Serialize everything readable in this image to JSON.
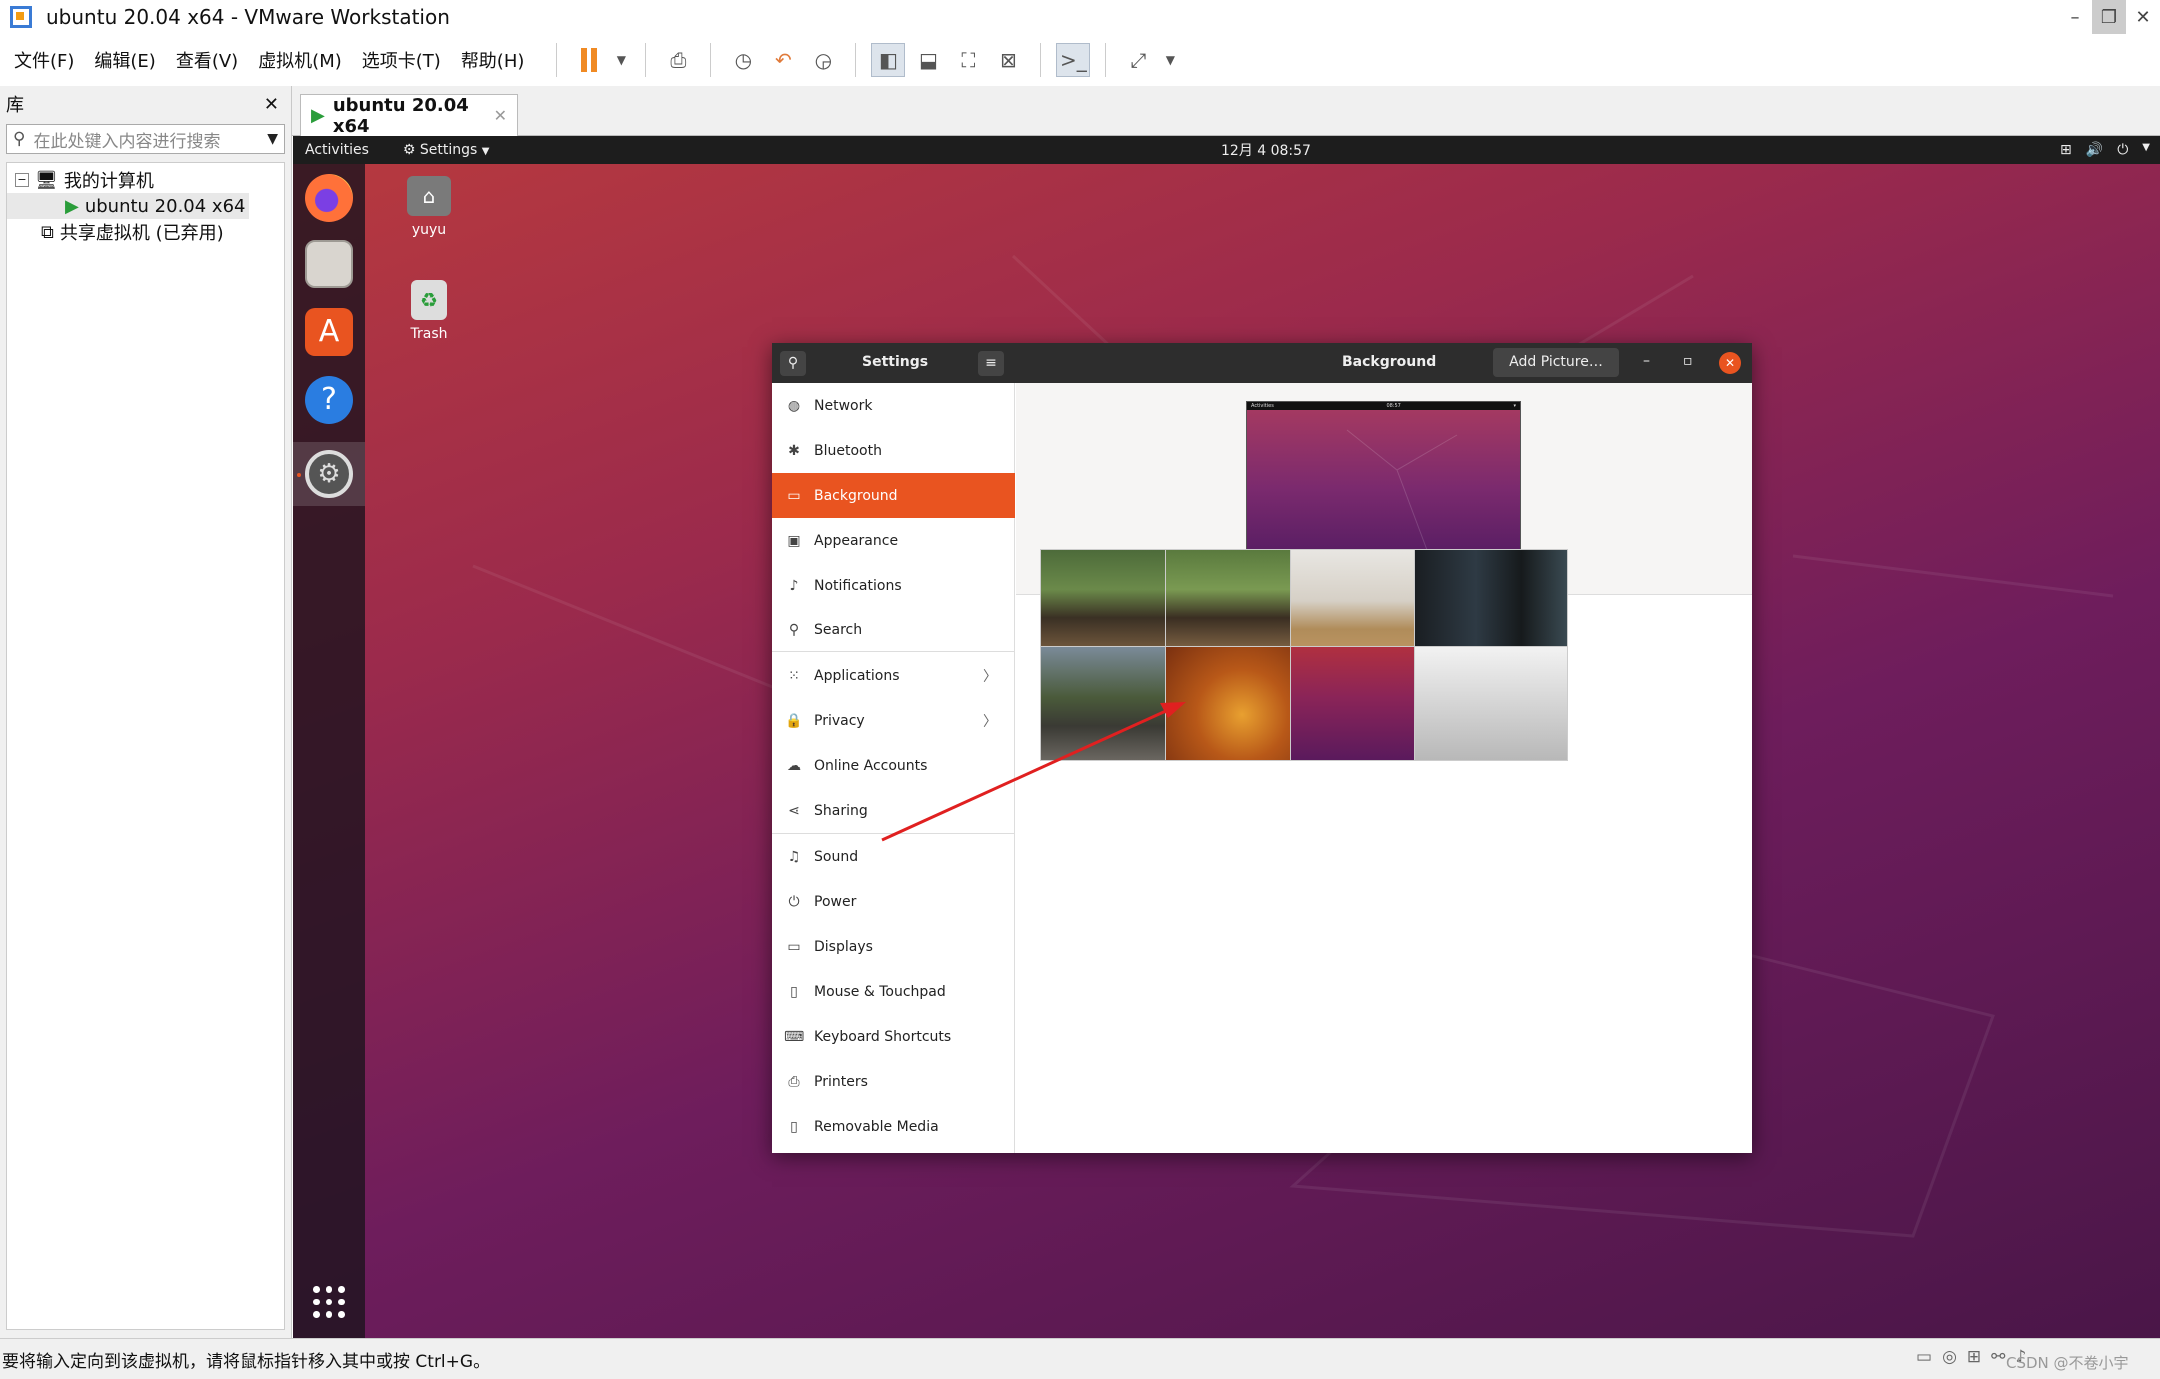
{
  "window": {
    "title": "ubuntu 20.04 x64 - VMware Workstation",
    "minimize": "–",
    "restore": "❐",
    "close": "✕"
  },
  "menu": [
    "文件(F)",
    "编辑(E)",
    "查看(V)",
    "虚拟机(M)",
    "选项卡(T)",
    "帮助(H)"
  ],
  "library": {
    "title": "库",
    "close": "✕",
    "search_placeholder": "在此处键入内容进行搜索",
    "tree": [
      {
        "label": "我的计算机"
      },
      {
        "label": "ubuntu 20.04 x64"
      },
      {
        "label": "共享虚拟机 (已弃用)"
      }
    ]
  },
  "tab": {
    "label": "ubuntu 20.04 x64",
    "close": "✕"
  },
  "ubuntu": {
    "activities": "Activities",
    "app_menu": "Settings",
    "clock": "12月 4  08:57",
    "desktop": [
      {
        "label": "yuyu"
      },
      {
        "label": "Trash"
      }
    ]
  },
  "settings": {
    "sidebar_title": "Settings",
    "page_title": "Background",
    "add_picture": "Add Picture…",
    "items": [
      {
        "label": "Network",
        "icon": "globe-icon",
        "glyph": "◍"
      },
      {
        "label": "Bluetooth",
        "icon": "bluetooth-icon",
        "glyph": "✱"
      },
      {
        "label": "Background",
        "icon": "background-icon",
        "glyph": "▭",
        "selected": true
      },
      {
        "label": "Appearance",
        "icon": "appearance-icon",
        "glyph": "▣"
      },
      {
        "label": "Notifications",
        "icon": "bell-icon",
        "glyph": "♪"
      },
      {
        "label": "Search",
        "icon": "search-icon",
        "glyph": "⚲"
      },
      {
        "label": "Applications",
        "icon": "grid-icon",
        "glyph": "⁙",
        "chevron": true
      },
      {
        "label": "Privacy",
        "icon": "lock-icon",
        "glyph": "🔒",
        "chevron": true
      },
      {
        "label": "Online Accounts",
        "icon": "cloud-icon",
        "glyph": "☁"
      },
      {
        "label": "Sharing",
        "icon": "share-icon",
        "glyph": "⋖"
      },
      {
        "label": "Sound",
        "icon": "music-icon",
        "glyph": "♫"
      },
      {
        "label": "Power",
        "icon": "power-icon",
        "glyph": "⏻"
      },
      {
        "label": "Displays",
        "icon": "display-icon",
        "glyph": "▭"
      },
      {
        "label": "Mouse & Touchpad",
        "icon": "mouse-icon",
        "glyph": "▯"
      },
      {
        "label": "Keyboard Shortcuts",
        "icon": "keyboard-icon",
        "glyph": "⌨"
      },
      {
        "label": "Printers",
        "icon": "printer-icon",
        "glyph": "⎙"
      },
      {
        "label": "Removable Media",
        "icon": "media-icon",
        "glyph": "▯"
      }
    ],
    "preview_topbar": {
      "activities": "Activities",
      "clock": "08:57"
    }
  },
  "status": {
    "message": "要将输入定向到该虚拟机，请将鼠标指针移入其中或按 Ctrl+G。",
    "watermark": "CSDN @不卷小宇"
  },
  "colors": {
    "accent": "#e95420",
    "vmware_orange": "#f08a24"
  }
}
